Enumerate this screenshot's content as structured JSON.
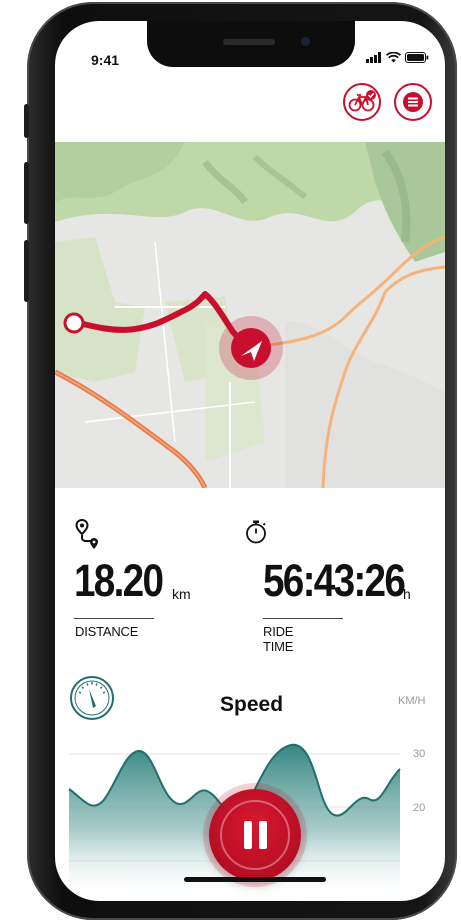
{
  "status_bar": {
    "time": "9:41"
  },
  "header": {
    "bike_icon": "bike-check-icon",
    "menu_icon": "hamburger-menu-icon"
  },
  "colors": {
    "accent": "#c8102e",
    "teal": "#1f6f6b",
    "route": "#c8102e"
  },
  "stats": {
    "distance": {
      "value": "18.20",
      "unit": "km",
      "label": "DISTANCE",
      "icon": "route-pin-icon"
    },
    "ride_time": {
      "value": "56:43:26",
      "unit": "h",
      "label": "RIDE TIME",
      "icon": "stopwatch-icon"
    }
  },
  "speed": {
    "title": "Speed",
    "unit": "KM/H",
    "ticks": [
      "30",
      "20"
    ],
    "icon": "speedometer-icon"
  },
  "controls": {
    "pause_icon": "pause-icon"
  }
}
